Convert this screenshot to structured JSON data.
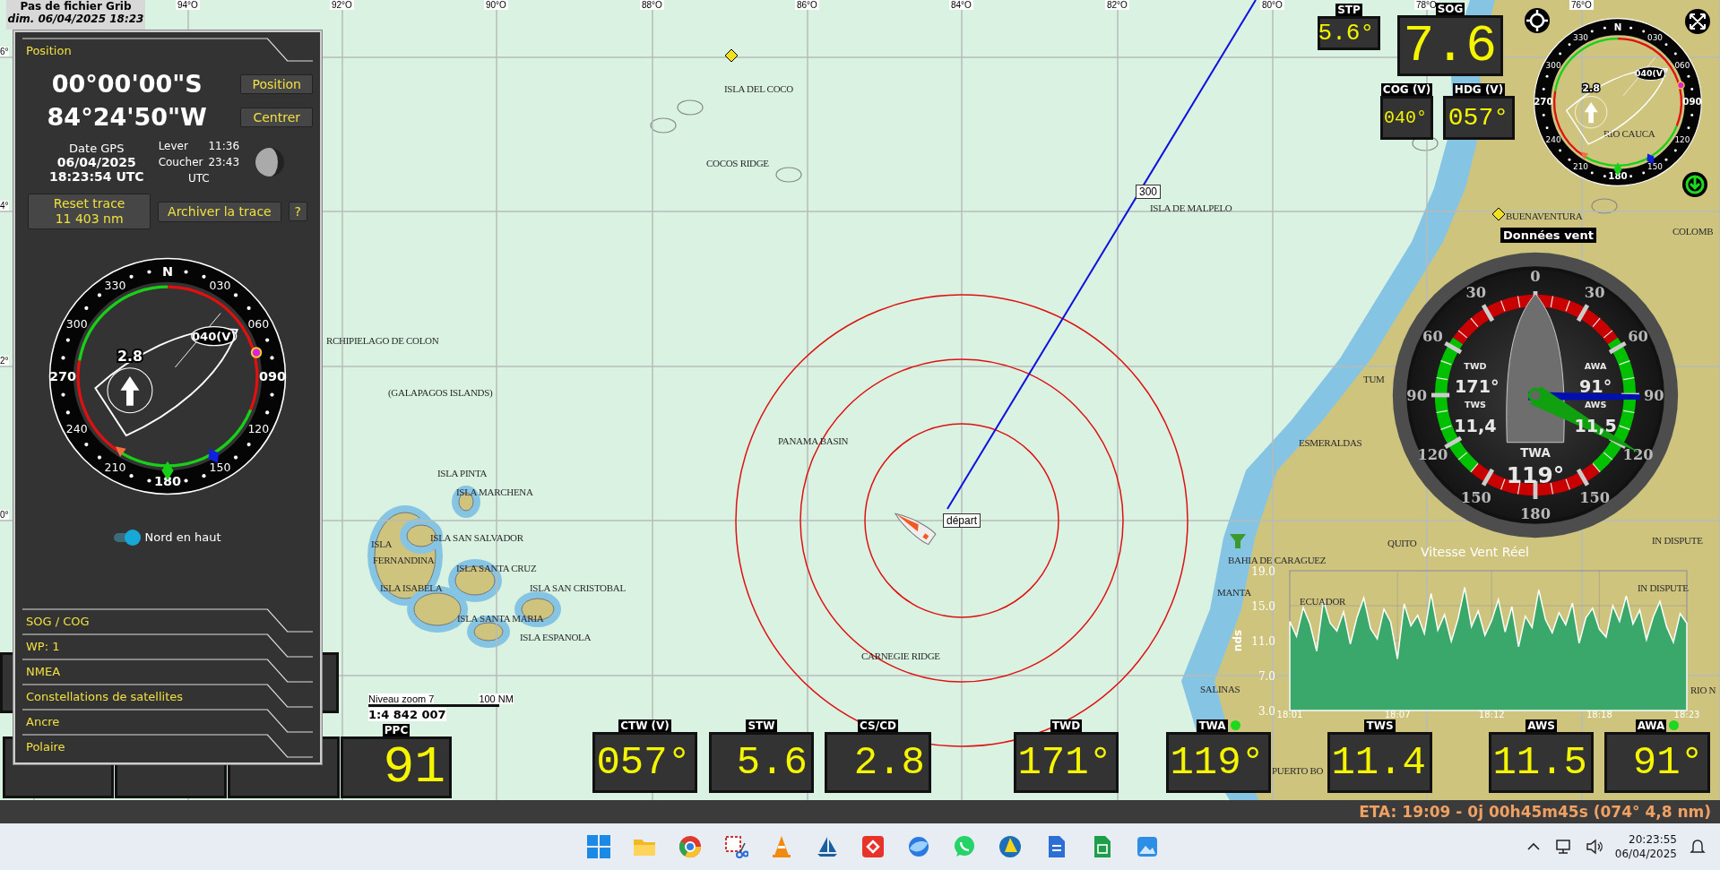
{
  "grib_notice": {
    "title": "Pas de fichier Grib",
    "date": "dim. 06/04/2025 18:23"
  },
  "map": {
    "longitude_labels": [
      "94°O",
      "92°O",
      "90°O",
      "88°O",
      "86°O",
      "84°O",
      "82°O",
      "80°O",
      "78°O",
      "76°O"
    ],
    "latitude_labels": [
      "6°",
      "4°",
      "2°",
      "0°"
    ],
    "place_labels": [
      "ISLA DEL COCO",
      "COCOS RIDGE",
      "ISLA DE MALPELO",
      "RCHIPIELAGO DE COLON",
      "(GALAPAGOS ISLANDS)",
      "PANAMA BASIN",
      "ISLA PINTA",
      "ISLA MARCHENA",
      "ISLA SAN SALVADOR",
      "ISLA",
      "FERNANDINA",
      "ISLA SANTA CRUZ",
      "ISLA ISABELA",
      "ISLA SAN CRISTOBAL",
      "ISLA SANTA MARIA",
      "ISLA ESPANOLA",
      "CARNEGIE RIDGE",
      "RIO CAUCA",
      "BUENAVENTURA",
      "COLOMB",
      "TUM",
      "ESMERALDAS",
      "QUITO",
      "IN DISPUTE",
      "BAHIA DE CARAGUEZ",
      "MANTA",
      "ECUADOR",
      "IN DISPUTE",
      "SALINAS",
      "RIO N",
      "PUERTO BO"
    ],
    "waypoint_label": "300",
    "boat_label": "départ",
    "scale": {
      "zoom": "Niveau zoom 7",
      "distance": "100 NM",
      "ratio": "1:4 842 007"
    }
  },
  "position_panel": {
    "title": "Position",
    "latitude": "00°00'00\"S",
    "longitude": "84°24'50\"W",
    "buttons": [
      "Position",
      "Centrer"
    ],
    "date_label": "Date GPS",
    "date": "06/04/2025",
    "time": "18:23:54 UTC",
    "sunrise_label": "Lever",
    "sunrise": "11:36",
    "sunset_label": "Coucher",
    "sunset": "23:43",
    "sun_zone": "UTC",
    "reset_button": {
      "label": "Reset trace",
      "value": "11 403 nm"
    },
    "archive_button": "Archiver la trace",
    "help_button": "?",
    "north_up_toggle": {
      "label": "Nord en haut",
      "on": true
    },
    "sections": [
      "SOG / COG",
      "WP: 1",
      "NMEA",
      "Constellations de satellites",
      "Ancre",
      "Polaire"
    ]
  },
  "panel_compass": {
    "ring_labels": [
      "N",
      "030",
      "060",
      "090",
      "120",
      "150",
      "180",
      "210",
      "240",
      "270",
      "300",
      "330"
    ],
    "heading_label": "040(V)",
    "current_speed": "2.8"
  },
  "instruments_top": [
    {
      "label": "STP",
      "value": "5.6°"
    },
    {
      "label": "SOG",
      "value": "7.6"
    },
    {
      "label": "COG (V)",
      "value": "040°"
    },
    {
      "label": "HDG (V)",
      "value": "057°"
    }
  ],
  "top_compass": {
    "ring_labels": [
      "N",
      "030",
      "060",
      "090",
      "120",
      "150",
      "180",
      "210",
      "240",
      "270",
      "300",
      "330"
    ],
    "heading_label": "040(V)",
    "current_speed": "2.8"
  },
  "wind_data_label": "Données vent",
  "wind_gauge": {
    "scale_labels": [
      "0",
      "30",
      "60",
      "90",
      "120",
      "150",
      "180",
      "150",
      "120",
      "90",
      "60",
      "30"
    ],
    "twd_label": "TWD",
    "twd": "171°",
    "awa_label": "AWA",
    "awa": "91°",
    "tws_label": "TWS",
    "tws": "11,4",
    "aws_label": "AWS",
    "aws": "11,5",
    "twa_label": "TWA",
    "twa": "119°"
  },
  "wind_chart": {
    "chart_data": {
      "type": "area",
      "title": "Vitesse Vent Réel",
      "ylabel": "nds",
      "grid": true,
      "ylim": [
        3,
        19
      ],
      "categories": [
        "18:01",
        null,
        null,
        null,
        null,
        null,
        null,
        null,
        null,
        null,
        null,
        null,
        null,
        null,
        null,
        null,
        "18:07",
        null,
        null,
        null,
        null,
        null,
        null,
        null,
        null,
        null,
        null,
        null,
        null,
        null,
        "18:12",
        null,
        null,
        null,
        null,
        null,
        null,
        null,
        null,
        null,
        null,
        null,
        null,
        null,
        null,
        null,
        "18:18",
        null,
        null,
        null,
        null,
        null,
        null,
        null,
        null,
        null,
        null,
        null,
        null,
        "18:23"
      ],
      "yticks": [
        {
          "value": 3,
          "label": "3.0"
        },
        {
          "value": 7,
          "label": "7.0"
        },
        {
          "value": 11,
          "label": "11.0"
        },
        {
          "value": 15,
          "label": "15.0"
        },
        {
          "value": 19,
          "label": "19.0"
        }
      ],
      "series": [
        {
          "color": "#3aa86b",
          "values": [
            13.2,
            11.5,
            14.8,
            12.9,
            9.8,
            15.6,
            13.0,
            12.1,
            14.3,
            10.6,
            13.7,
            15.9,
            12.4,
            11.2,
            14.6,
            13.1,
            8.9,
            15.2,
            12.7,
            13.9,
            11.8,
            16.4,
            12.2,
            14.0,
            10.9,
            13.5,
            17.1,
            12.6,
            14.4,
            11.6,
            13.3,
            15.7,
            12.0,
            14.9,
            10.3,
            13.8,
            12.5,
            16.8,
            13.4,
            11.9,
            14.2,
            12.8,
            15.3,
            10.7,
            13.6,
            14.7,
            12.3,
            11.4,
            15.0,
            13.2,
            16.1,
            12.9,
            14.5,
            11.1,
            13.7,
            15.5,
            12.6,
            10.8,
            14.1,
            13.0
          ]
        }
      ]
    }
  },
  "instruments_bottom": [
    {
      "label": "PPC",
      "value": "91",
      "indicator": false
    },
    {
      "label": "CTW (V)",
      "value": "057°",
      "indicator": false
    },
    {
      "label": "STW",
      "value": "5.6",
      "indicator": false
    },
    {
      "label": "CS/CD",
      "value": "2.8",
      "indicator": false
    },
    {
      "label": "TWD",
      "value": "171°",
      "indicator": false
    },
    {
      "label": "TWA",
      "value": "119°",
      "indicator": true
    },
    {
      "label": "TWS",
      "value": "11.4",
      "indicator": false
    },
    {
      "label": "AWS",
      "value": "11.5",
      "indicator": false
    },
    {
      "label": "AWA",
      "value": "91°",
      "indicator": true
    }
  ],
  "eta": "ETA: 19:09 - 0j 00h45m45s (074° 4,8 nm)",
  "taskbar": {
    "time": "20:23:55",
    "date": "06/04/2025"
  }
}
